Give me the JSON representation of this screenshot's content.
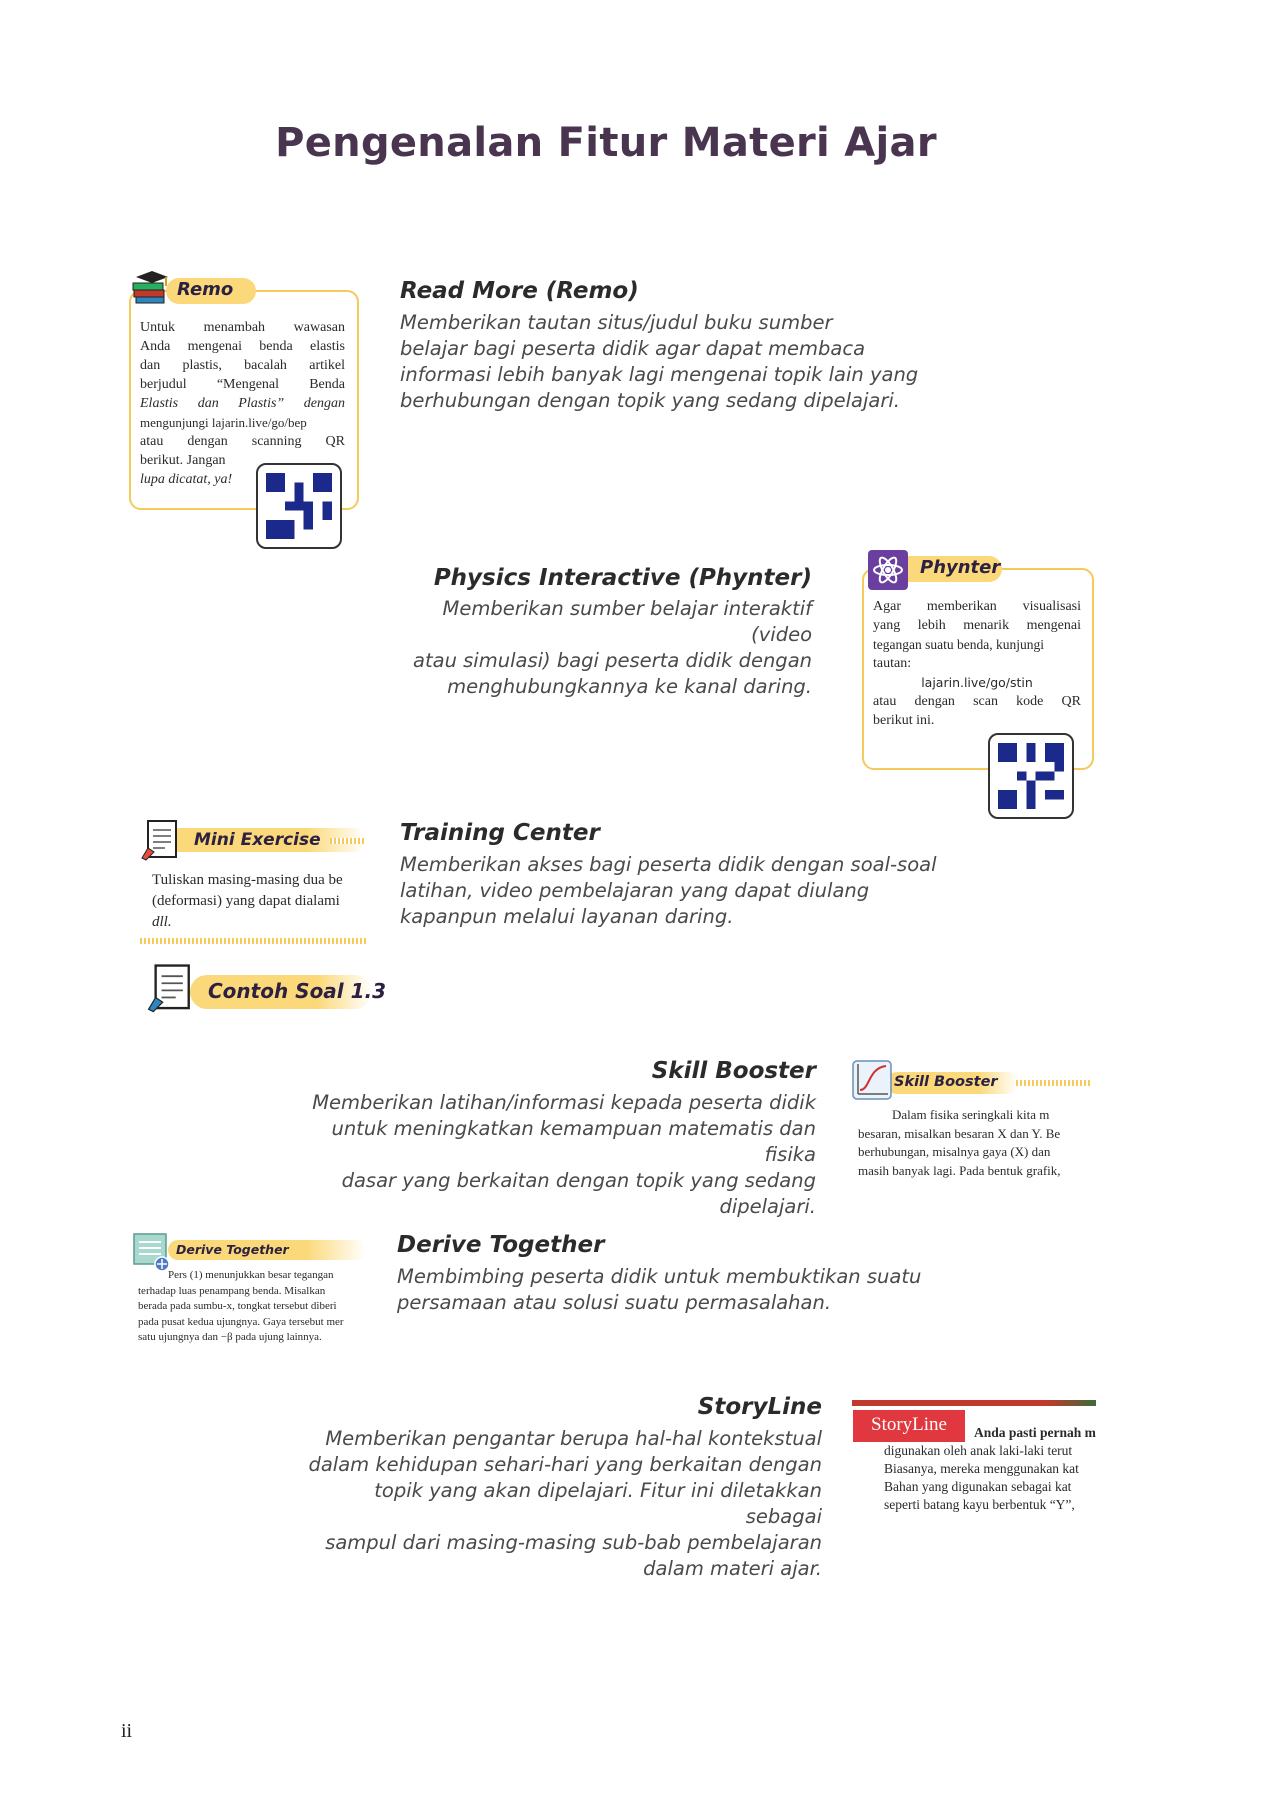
{
  "page": {
    "title": "Pengenalan Fitur Materi Ajar",
    "page_number": "ii"
  },
  "features": {
    "read_more": {
      "title": "Read More (Remo)",
      "desc": [
        "Memberikan tautan situs/judul buku sumber",
        "belajar bagi peserta didik agar dapat membaca",
        "informasi lebih banyak lagi mengenai topik lain yang",
        "berhubungan dengan topik yang sedang dipelajari."
      ]
    },
    "physics_interactive": {
      "title": "Physics Interactive (Phynter)",
      "desc": [
        "Memberikan sumber belajar interaktif (video",
        "atau simulasi) bagi peserta didik dengan",
        "menghubungkannya ke kanal daring."
      ]
    },
    "training_center": {
      "title": "Training Center",
      "desc": [
        "Memberikan akses bagi peserta didik dengan soal-soal",
        "latihan, video pembelajaran yang dapat diulang",
        "kapanpun melalui layanan daring."
      ]
    },
    "skill_booster": {
      "title": "Skill Booster",
      "desc": [
        "Memberikan latihan/informasi kepada peserta didik",
        "untuk meningkatkan kemampuan matematis dan fisika",
        "dasar yang berkaitan dengan topik yang sedang",
        "dipelajari."
      ]
    },
    "derive_together": {
      "title": "Derive Together",
      "desc": [
        "Membimbing peserta didik untuk membuktikan suatu",
        "persamaan atau solusi suatu permasalahan."
      ]
    },
    "storyline": {
      "title": "StoryLine",
      "desc": [
        "Memberikan pengantar berupa hal-hal kontekstual",
        "dalam kehidupan sehari-hari yang berkaitan dengan",
        "topik yang akan dipelajari. Fitur ini diletakkan sebagai",
        "sampul dari masing-masing sub-bab pembelajaran",
        "dalam materi ajar."
      ]
    }
  },
  "samples": {
    "remo": {
      "label": "Remo",
      "lines": [
        "Untuk menambah wawasan",
        "Anda mengenai benda elastis",
        "dan plastis, bacalah artikel",
        "berjudul “Mengenal Benda",
        "Elastis dan Plastis” dengan",
        "mengunjungi lajarin.live/go/bep",
        "atau dengan scanning QR",
        "berikut. Jangan",
        "lupa dicatat, ya!"
      ]
    },
    "phynter": {
      "label": "Phynter",
      "lines": [
        "Agar memberikan visualisasi",
        "yang lebih menarik mengenai",
        "tegangan suatu benda, kunjungi",
        "tautan:"
      ],
      "link": "lajarin.live/go/stin",
      "lines2": [
        "atau dengan scan kode QR",
        "berikut ini."
      ]
    },
    "mini_exercise": {
      "label": "Mini Exercise",
      "lines": [
        "Tuliskan masing-masing dua be",
        "(deformasi) yang dapat dialami",
        "dll."
      ]
    },
    "contoh_soal": {
      "label": "Contoh Soal 1.3"
    },
    "skill_booster": {
      "label": "Skill Booster",
      "lines": [
        "Dalam fisika seringkali kita m",
        "besaran, misalkan besaran X dan Y. Be",
        "berhubungan, misalnya gaya (X) dan",
        "masih banyak lagi. Pada bentuk grafik,"
      ]
    },
    "derive_together": {
      "label": "Derive Together",
      "lines": [
        "Pers (1) menunjukkan besar tegangan",
        "terhadap luas penampang benda. Misalkan",
        "berada pada sumbu-x, tongkat tersebut diberi",
        "pada pusat kedua ujungnya. Gaya tersebut mer",
        "satu ujungnya dan −β pada ujung lainnya."
      ]
    },
    "storyline": {
      "label": "StoryLine",
      "lines": [
        "Anda pasti pernah m",
        "digunakan oleh anak laki-laki terut",
        "Biasanya, mereka menggunakan kat",
        "Bahan yang digunakan sebagai kat",
        "seperti batang kayu berbentuk “Y”,"
      ]
    }
  },
  "colors": {
    "title": "#4a3550",
    "accent_yellow": "#fbd97a",
    "card_border": "#f5c95a",
    "storyline_red": "#e0383e",
    "phynter_purple": "#6a3fa0"
  },
  "icons": [
    "graduation-books-icon",
    "atom-icon",
    "notepad-pencil-icon",
    "graph-icon",
    "derivation-sheet-icon",
    "qr-code-icon"
  ]
}
